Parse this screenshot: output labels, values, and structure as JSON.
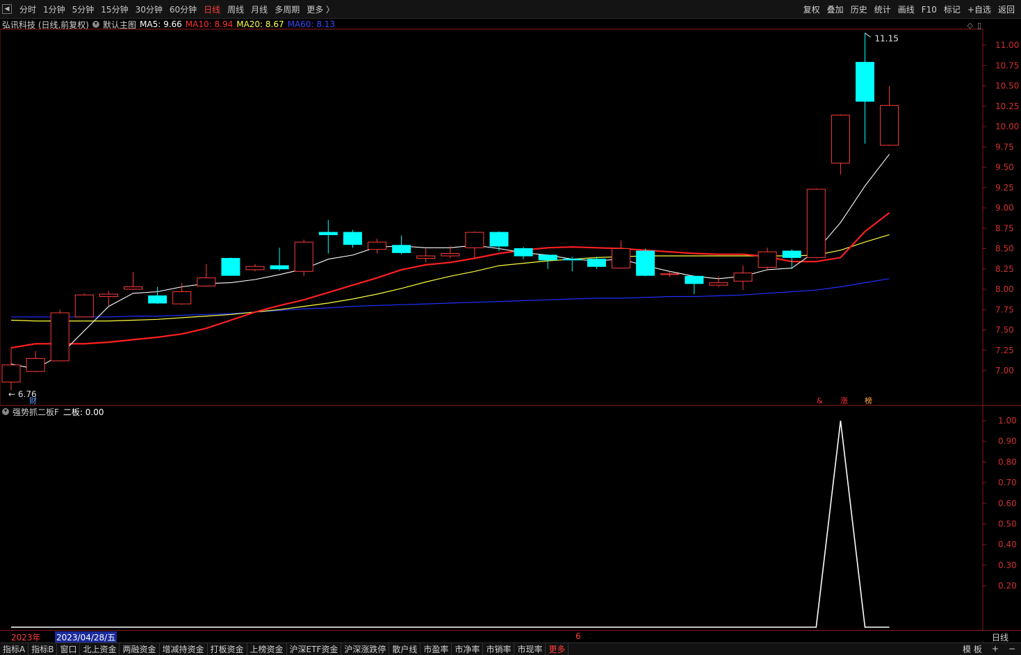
{
  "toolbar": {
    "back_icon": "back-arrow-icon",
    "periods": [
      "分时",
      "1分钟",
      "5分钟",
      "15分钟",
      "30分钟",
      "60分钟",
      "日线",
      "周线",
      "月线",
      "多周期",
      "更多 〉"
    ],
    "active_period": "日线",
    "tools": [
      "复权",
      "叠加",
      "历史",
      "统计",
      "画线",
      "F10",
      "标记",
      "+自选",
      "返回"
    ]
  },
  "main_panel": {
    "stock_label": "弘讯科技 (日线,前复权)",
    "template_label": "默认主图",
    "ma5": "MA5: 9.66",
    "ma10": "MA10: 8.94",
    "ma20": "MA20: 8.67",
    "ma60": "MA60: 8.13",
    "high_label": "11.15",
    "low_label": "6.76",
    "marker_cai": "财",
    "markers_right": [
      "&",
      "涨",
      "榜"
    ]
  },
  "indicator_panel": {
    "name": "强势抓二板F",
    "value": "二板: 0.00"
  },
  "colors": {
    "up": "#ff3b3b",
    "down": "#00ffff",
    "ma5": "#ffffff",
    "ma10": "#ff2020",
    "ma20": "#ffff40",
    "ma60": "#2030ff",
    "axis": "#8b1a1a"
  },
  "chart_data": [
    {
      "type": "candlestick",
      "title": "弘讯科技 (日线,前复权)",
      "y_ticks": [
        "11.00",
        "10.75",
        "10.50",
        "10.25",
        "10.00",
        "9.75",
        "9.50",
        "9.25",
        "9.00",
        "8.75",
        "8.50",
        "8.25",
        "8.00",
        "7.75",
        "7.50",
        "7.25",
        "7.00"
      ],
      "ylim": [
        6.76,
        11.15
      ],
      "candles": [
        {
          "o": 6.86,
          "h": 7.28,
          "l": 6.76,
          "c": 7.07
        },
        {
          "o": 6.99,
          "h": 7.24,
          "l": 6.98,
          "c": 7.15
        },
        {
          "o": 7.12,
          "h": 7.75,
          "l": 7.12,
          "c": 7.71
        },
        {
          "o": 7.66,
          "h": 7.95,
          "l": 7.66,
          "c": 7.93
        },
        {
          "o": 7.91,
          "h": 7.98,
          "l": 7.8,
          "c": 7.94
        },
        {
          "o": 8.0,
          "h": 8.21,
          "l": 7.99,
          "c": 8.03
        },
        {
          "o": 7.92,
          "h": 8.03,
          "l": 7.82,
          "c": 7.83
        },
        {
          "o": 7.82,
          "h": 8.08,
          "l": 7.81,
          "c": 7.97
        },
        {
          "o": 8.04,
          "h": 8.31,
          "l": 8.03,
          "c": 8.14
        },
        {
          "o": 8.38,
          "h": 8.39,
          "l": 8.17,
          "c": 8.17
        },
        {
          "o": 8.24,
          "h": 8.31,
          "l": 8.22,
          "c": 8.28
        },
        {
          "o": 8.29,
          "h": 8.51,
          "l": 8.23,
          "c": 8.25
        },
        {
          "o": 8.22,
          "h": 8.61,
          "l": 8.16,
          "c": 8.58
        },
        {
          "o": 8.7,
          "h": 8.85,
          "l": 8.44,
          "c": 8.67
        },
        {
          "o": 8.7,
          "h": 8.73,
          "l": 8.51,
          "c": 8.55
        },
        {
          "o": 8.49,
          "h": 8.62,
          "l": 8.44,
          "c": 8.58
        },
        {
          "o": 8.54,
          "h": 8.66,
          "l": 8.43,
          "c": 8.45
        },
        {
          "o": 8.38,
          "h": 8.5,
          "l": 8.33,
          "c": 8.41
        },
        {
          "o": 8.41,
          "h": 8.53,
          "l": 8.38,
          "c": 8.44
        },
        {
          "o": 8.51,
          "h": 8.71,
          "l": 8.38,
          "c": 8.7
        },
        {
          "o": 8.7,
          "h": 8.71,
          "l": 8.47,
          "c": 8.53
        },
        {
          "o": 8.5,
          "h": 8.52,
          "l": 8.37,
          "c": 8.41
        },
        {
          "o": 8.42,
          "h": 8.43,
          "l": 8.25,
          "c": 8.36
        },
        {
          "o": 8.37,
          "h": 8.4,
          "l": 8.22,
          "c": 8.36
        },
        {
          "o": 8.37,
          "h": 8.4,
          "l": 8.25,
          "c": 8.28
        },
        {
          "o": 8.26,
          "h": 8.6,
          "l": 8.26,
          "c": 8.5
        },
        {
          "o": 8.47,
          "h": 8.5,
          "l": 8.16,
          "c": 8.17
        },
        {
          "o": 8.18,
          "h": 8.22,
          "l": 8.15,
          "c": 8.19
        },
        {
          "o": 8.16,
          "h": 8.17,
          "l": 7.94,
          "c": 8.07
        },
        {
          "o": 8.05,
          "h": 8.16,
          "l": 8.03,
          "c": 8.08
        },
        {
          "o": 8.1,
          "h": 8.29,
          "l": 7.99,
          "c": 8.2
        },
        {
          "o": 8.27,
          "h": 8.51,
          "l": 8.24,
          "c": 8.46
        },
        {
          "o": 8.47,
          "h": 8.49,
          "l": 8.25,
          "c": 8.39
        },
        {
          "o": 8.39,
          "h": 9.24,
          "l": 8.38,
          "c": 9.23
        },
        {
          "o": 9.55,
          "h": 10.15,
          "l": 9.41,
          "c": 10.14
        },
        {
          "o": 10.79,
          "h": 11.15,
          "l": 9.79,
          "c": 10.31
        },
        {
          "o": 9.77,
          "h": 10.5,
          "l": 9.76,
          "c": 10.26
        }
      ],
      "ma5": [
        7.08,
        7.02,
        7.19,
        7.49,
        7.79,
        7.95,
        7.97,
        8.03,
        8.07,
        8.08,
        8.12,
        8.18,
        8.25,
        8.37,
        8.42,
        8.52,
        8.53,
        8.51,
        8.51,
        8.54,
        8.5,
        8.45,
        8.42,
        8.37,
        8.35,
        8.37,
        8.29,
        8.22,
        8.16,
        8.13,
        8.16,
        8.24,
        8.26,
        8.47,
        8.82,
        9.27,
        9.66
      ],
      "ma10": [
        7.28,
        7.33,
        7.33,
        7.33,
        7.35,
        7.38,
        7.41,
        7.45,
        7.52,
        7.62,
        7.72,
        7.8,
        7.87,
        7.96,
        8.05,
        8.14,
        8.24,
        8.3,
        8.33,
        8.38,
        8.44,
        8.48,
        8.51,
        8.52,
        8.51,
        8.5,
        8.48,
        8.46,
        8.44,
        8.43,
        8.43,
        8.4,
        8.34,
        8.34,
        8.39,
        8.71,
        8.94
      ],
      "ma20": [
        7.62,
        7.61,
        7.61,
        7.61,
        7.61,
        7.62,
        7.63,
        7.65,
        7.67,
        7.69,
        7.72,
        7.75,
        7.79,
        7.83,
        7.88,
        7.94,
        8.01,
        8.09,
        8.16,
        8.22,
        8.29,
        8.32,
        8.35,
        8.37,
        8.39,
        8.4,
        8.41,
        8.41,
        8.41,
        8.41,
        8.41,
        8.41,
        8.41,
        8.42,
        8.48,
        8.58,
        8.67
      ],
      "ma60": [
        7.66,
        7.66,
        7.66,
        7.66,
        7.66,
        7.67,
        7.67,
        7.68,
        7.69,
        7.7,
        7.72,
        7.74,
        7.76,
        7.77,
        7.79,
        7.8,
        7.81,
        7.82,
        7.83,
        7.84,
        7.85,
        7.86,
        7.87,
        7.88,
        7.89,
        7.89,
        7.9,
        7.91,
        7.91,
        7.92,
        7.93,
        7.95,
        7.97,
        7.99,
        8.03,
        8.08,
        8.13
      ]
    },
    {
      "type": "line",
      "title": "强势抓二板F",
      "y_ticks": [
        "1.00",
        "0.90",
        "0.80",
        "0.70",
        "0.60",
        "0.50",
        "0.40",
        "0.30",
        "0.20"
      ],
      "ylim": [
        0,
        1
      ],
      "series": [
        {
          "name": "二板",
          "values": [
            0,
            0,
            0,
            0,
            0,
            0,
            0,
            0,
            0,
            0,
            0,
            0,
            0,
            0,
            0,
            0,
            0,
            0,
            0,
            0,
            0,
            0,
            0,
            0,
            0,
            0,
            0,
            0,
            0,
            0,
            0,
            0,
            0,
            0,
            1,
            0,
            0
          ]
        }
      ]
    }
  ],
  "date_bar": {
    "year_label": "2023年",
    "date_label": "2023/04/28/五",
    "month_mark": "6",
    "period_label": "日线"
  },
  "bottom_tabs": [
    "指标A",
    "指标B",
    "窗口",
    "北上资金",
    "两融资金",
    "增减持资金",
    "打板资金",
    "上榜资金",
    "沪深ETF资金",
    "沪深涨跌停",
    "散户线",
    "市盈率",
    "市净率",
    "市销率",
    "市现率",
    "更多"
  ],
  "bottom_active": "更多",
  "bottom_right": [
    "模 板",
    "+",
    "−"
  ]
}
